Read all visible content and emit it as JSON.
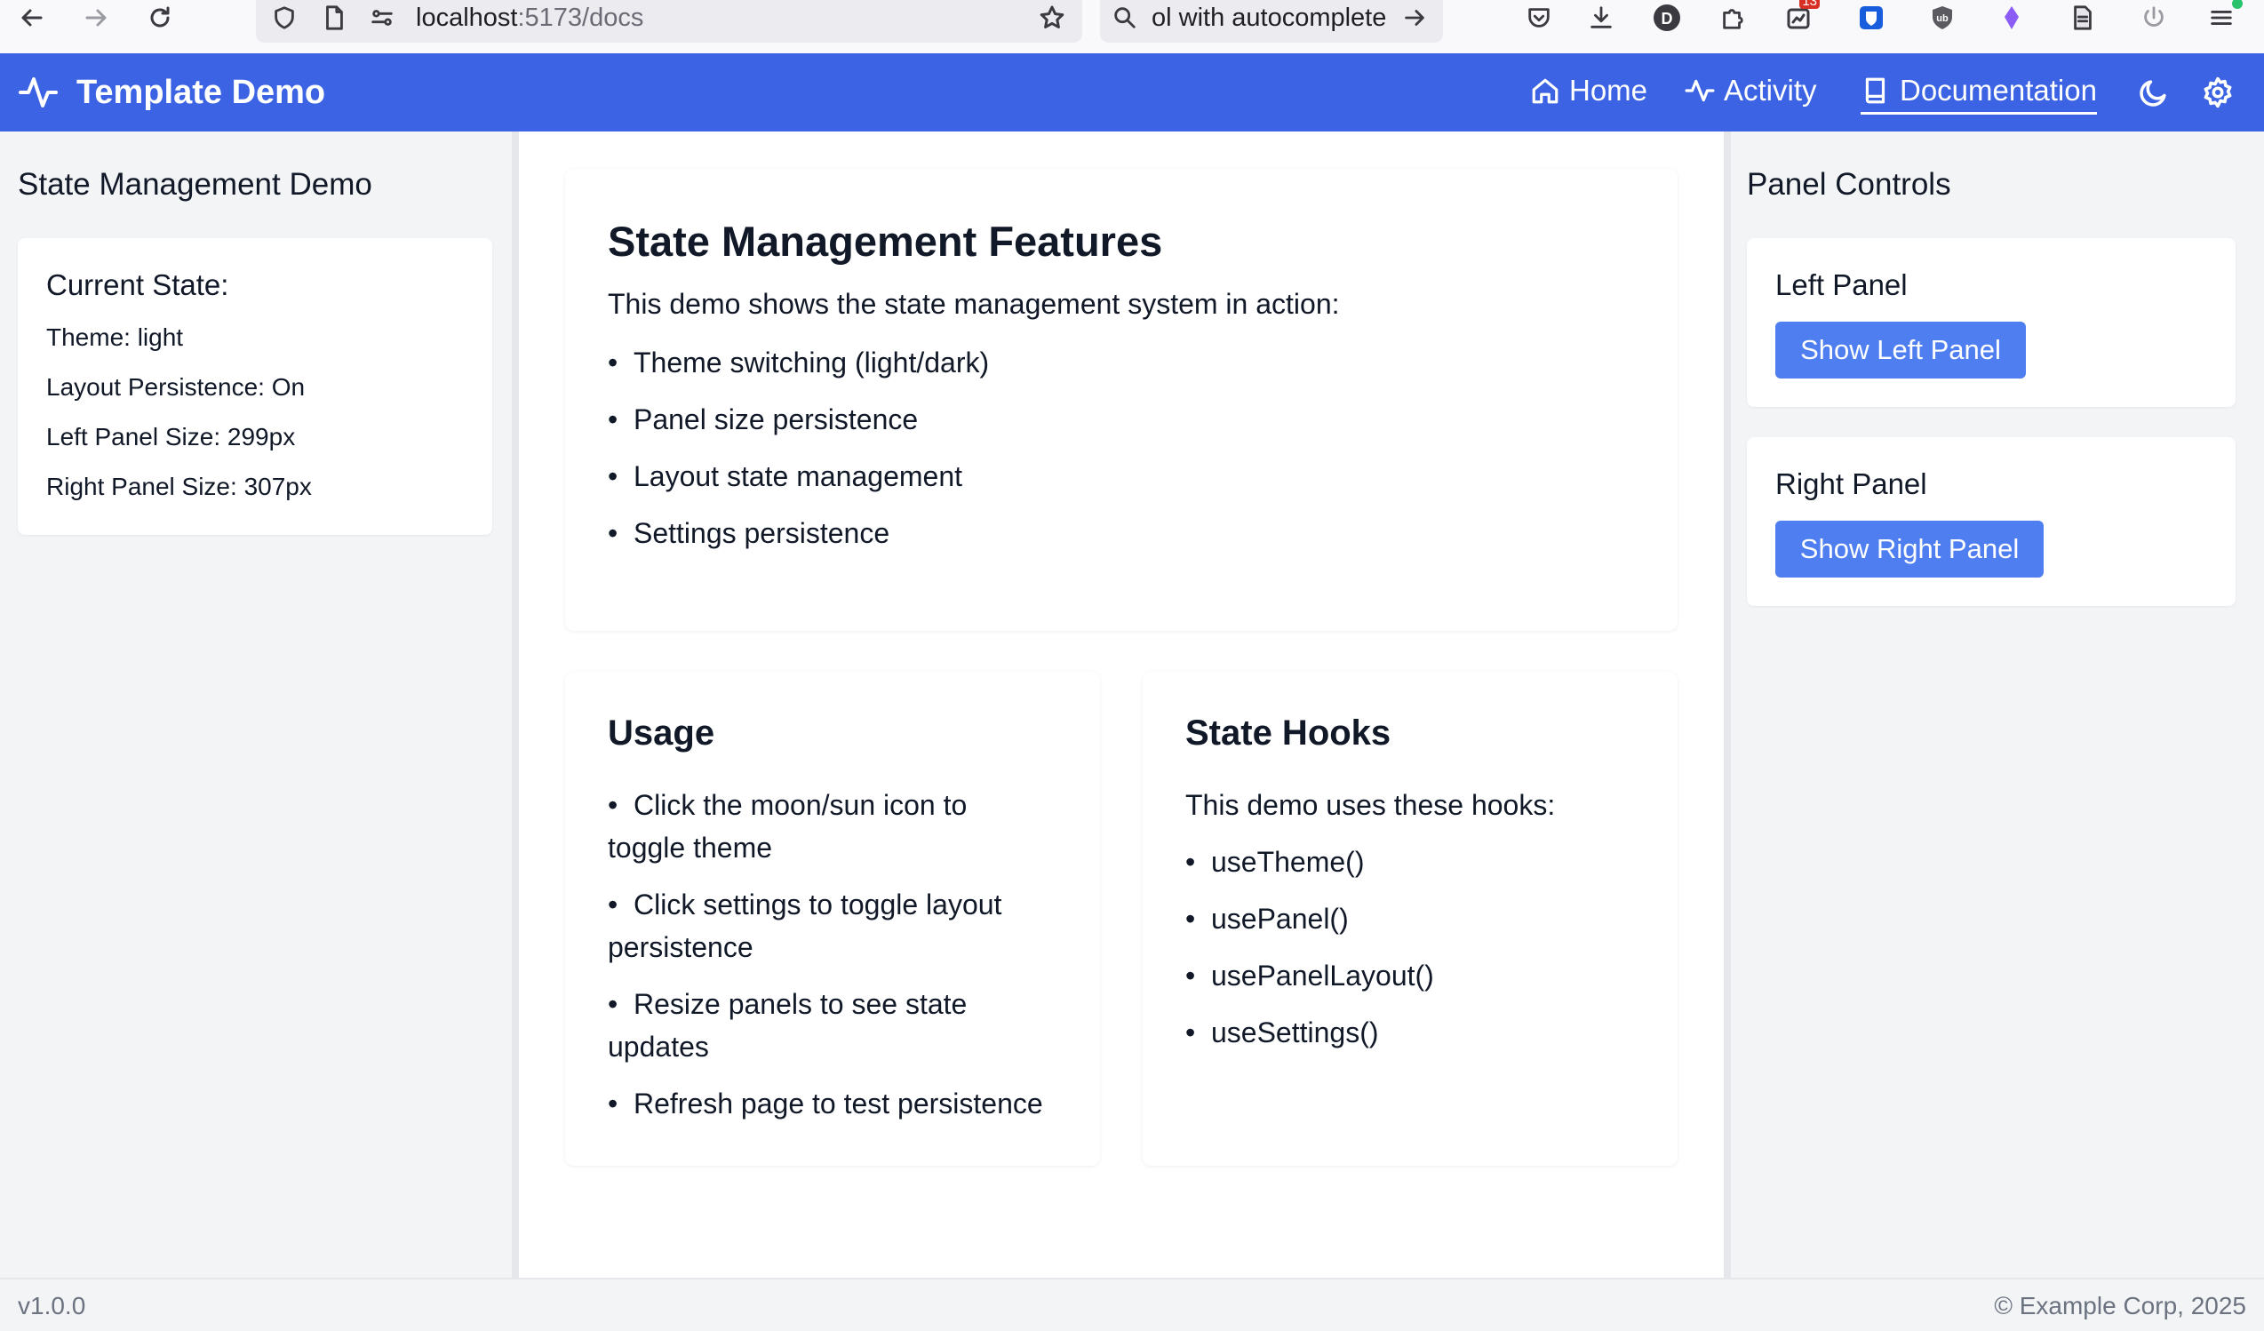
{
  "browser": {
    "url_host": "localhost",
    "url_path": ":5173/docs",
    "search_text": "ol with autocomplete",
    "badge_count": "13"
  },
  "app": {
    "title": "Template Demo",
    "nav": {
      "home": "Home",
      "activity": "Activity",
      "documentation": "Documentation",
      "active": "Documentation"
    },
    "accent_color": "#3b63e3"
  },
  "left_panel": {
    "title": "State Management Demo",
    "card_title": "Current State:",
    "state_lines": [
      "Theme: light",
      "Layout Persistence: On",
      "Left Panel Size: 299px",
      "Right Panel Size: 307px"
    ]
  },
  "main": {
    "features": {
      "title": "State Management Features",
      "intro": "This demo shows the state management system in action:",
      "items": [
        "Theme switching (light/dark)",
        "Panel size persistence",
        "Layout state management",
        "Settings persistence"
      ]
    },
    "usage": {
      "title": "Usage",
      "items": [
        [
          "Click the moon/sun icon to",
          "toggle theme"
        ],
        [
          "Click settings to toggle layout",
          "persistence"
        ],
        [
          "Resize panels to see state",
          "updates"
        ],
        [
          "Refresh page to test persistence"
        ]
      ]
    },
    "hooks": {
      "title": "State Hooks",
      "intro": "This demo uses these hooks:",
      "items": [
        "useTheme()",
        "usePanel()",
        "usePanelLayout()",
        "useSettings()"
      ]
    }
  },
  "right_panel": {
    "title": "Panel Controls",
    "left_card_title": "Left Panel",
    "left_button": "Show Left Panel",
    "right_card_title": "Right Panel",
    "right_button": "Show Right Panel"
  },
  "footer": {
    "version": "v1.0.0",
    "copyright": "© Example Corp, 2025"
  }
}
